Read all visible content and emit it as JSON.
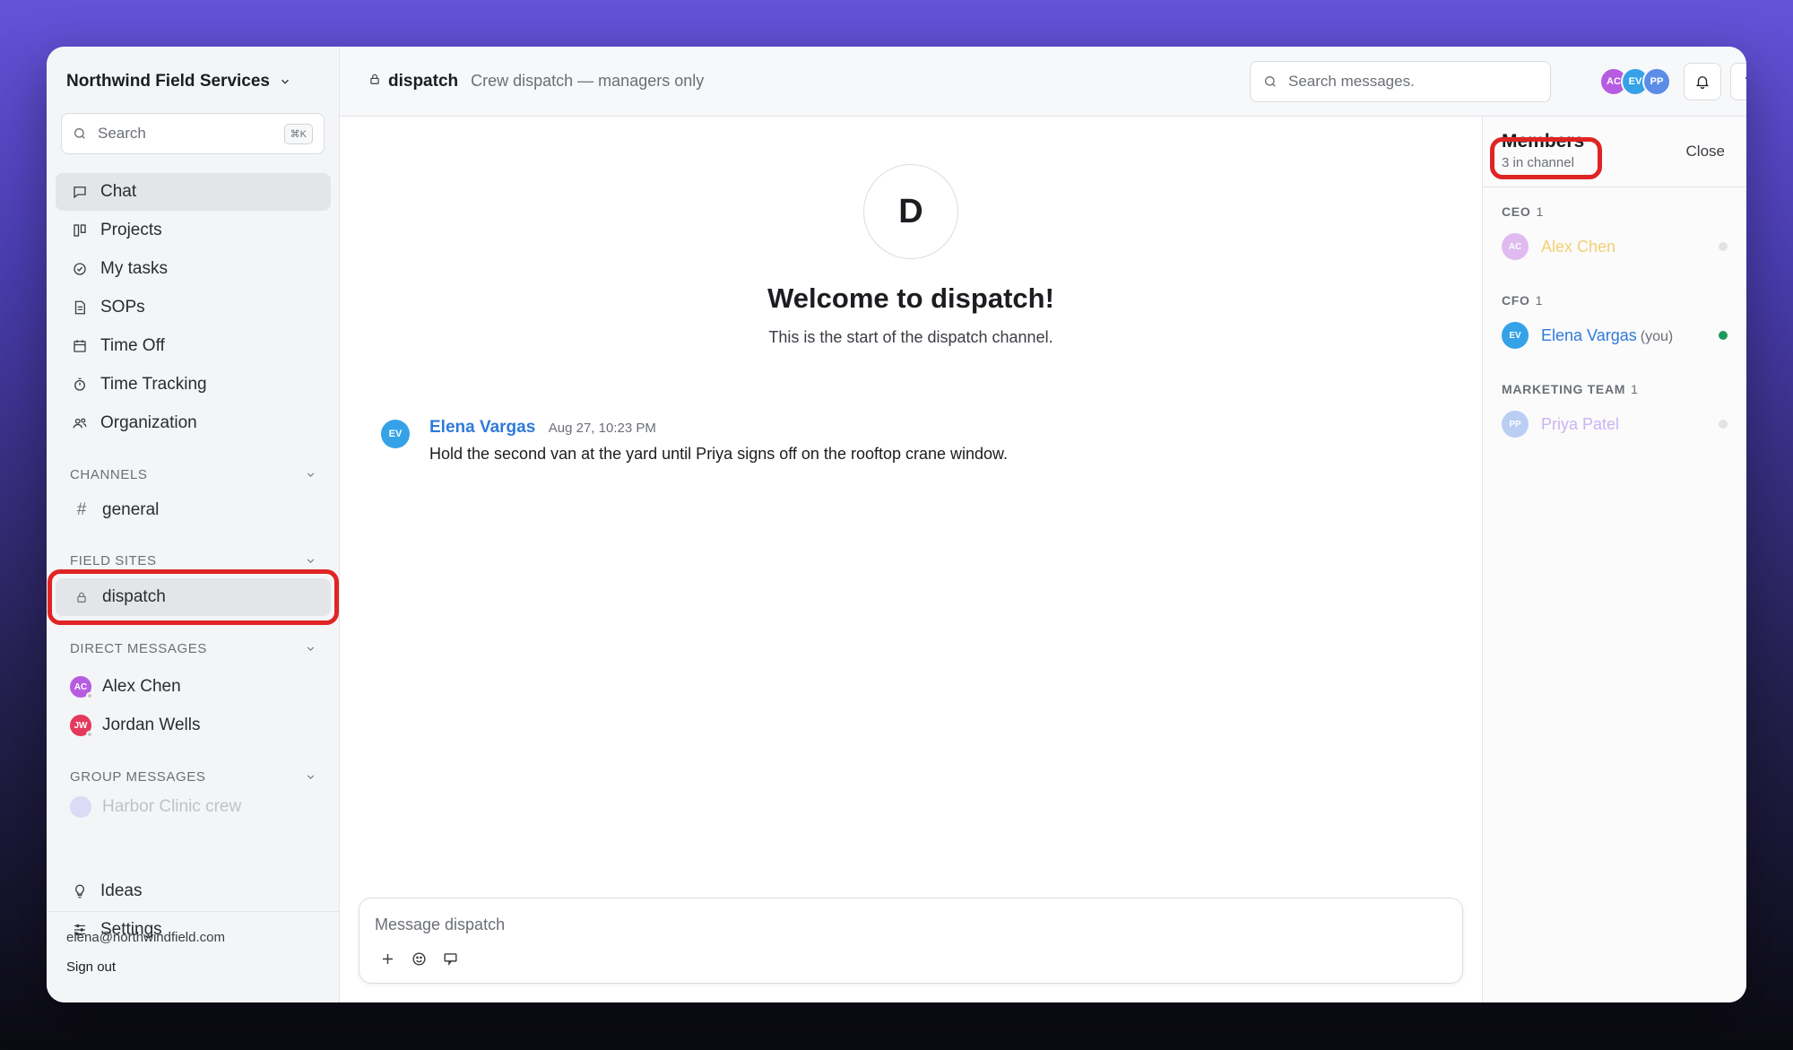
{
  "workspace": {
    "name": "Northwind Field Services"
  },
  "sidebar": {
    "search_placeholder": "Search",
    "search_shortcut": "⌘K",
    "nav": [
      {
        "label": "Chat",
        "icon": "chat-bubble-icon"
      },
      {
        "label": "Projects",
        "icon": "kanban-icon"
      },
      {
        "label": "My tasks",
        "icon": "check-circle-icon"
      },
      {
        "label": "SOPs",
        "icon": "document-icon"
      },
      {
        "label": "Time Off",
        "icon": "calendar-icon"
      },
      {
        "label": "Time Tracking",
        "icon": "stopwatch-icon"
      },
      {
        "label": "Organization",
        "icon": "people-icon"
      }
    ],
    "channels_label": "CHANNELS",
    "channels": [
      {
        "label": "general"
      }
    ],
    "field_sites_label": "FIELD SITES",
    "field_sites": [
      {
        "label": "dispatch"
      }
    ],
    "direct_messages_label": "DIRECT MESSAGES",
    "direct_messages": [
      {
        "label": "Alex Chen",
        "initials": "AC",
        "color": "#b65ce0"
      },
      {
        "label": "Jordan Wells",
        "initials": "JW",
        "color": "#e5395b"
      }
    ],
    "group_messages_label": "GROUP MESSAGES",
    "group_messages": [
      {
        "label": "Harbor Clinic crew"
      }
    ],
    "bottom_nav": [
      {
        "label": "Ideas",
        "icon": "lightbulb-icon"
      },
      {
        "label": "Settings",
        "icon": "sliders-icon"
      }
    ],
    "user_email": "elena@northwindfield.com",
    "sign_out": "Sign out"
  },
  "header": {
    "channel_name": "dispatch",
    "channel_desc": "Crew dispatch — managers only",
    "search_placeholder": "Search messages.",
    "avatars": [
      {
        "initials": "AC",
        "color": "#b65ce0"
      },
      {
        "initials": "EV",
        "color": "#35a2e8"
      },
      {
        "initials": "PP",
        "color": "#5b8de8"
      }
    ],
    "help": "?"
  },
  "chat": {
    "welcome_letter": "D",
    "welcome_title": "Welcome to dispatch!",
    "welcome_sub": "This is the start of the dispatch channel.",
    "messages": [
      {
        "author": "Elena Vargas",
        "initials": "EV",
        "time": "Aug 27, 10:23 PM",
        "text": "Hold the second van at the yard until Priya signs off on the rooftop crane window."
      }
    ],
    "composer_placeholder": "Message dispatch"
  },
  "members": {
    "title": "Members",
    "count": "3 in channel",
    "close": "Close",
    "groups": [
      {
        "label": "CEO",
        "count": "1",
        "member": {
          "name": "Alex Chen",
          "initials": "AC",
          "you": ""
        }
      },
      {
        "label": "CFO",
        "count": "1",
        "member": {
          "name": "Elena Vargas",
          "initials": "EV",
          "you": "(you)"
        }
      },
      {
        "label": "MARKETING TEAM",
        "count": "1",
        "member": {
          "name": "Priya Patel",
          "initials": "PP",
          "you": ""
        }
      }
    ]
  }
}
